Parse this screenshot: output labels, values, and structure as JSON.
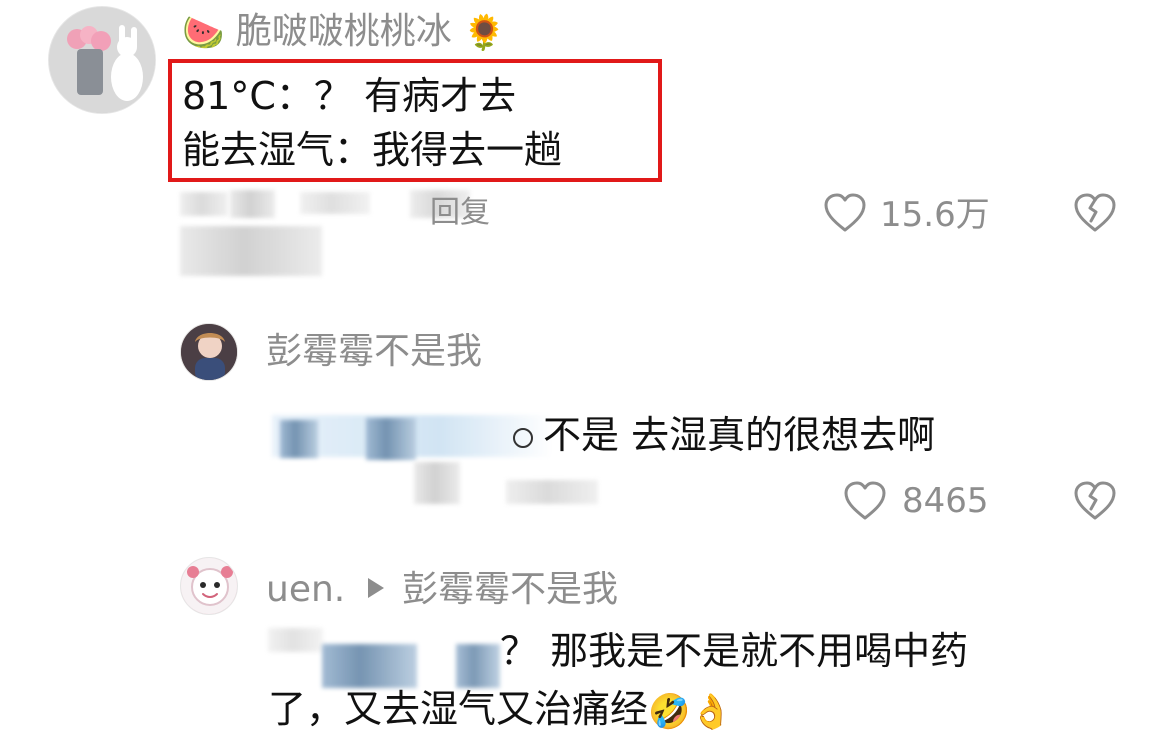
{
  "comment_1": {
    "username": "脆啵啵桃桃冰",
    "emoji_left": "🍉",
    "emoji_right": "🌻",
    "highlight_lines": [
      "81°C：？ 有病才去",
      "能去湿气：我得去一趟"
    ],
    "reply_label": "回复",
    "likes": "15.6万"
  },
  "comment_2": {
    "username": "彭霉霉不是我",
    "text": "不是 去湿真的很想去啊",
    "likes": "8465"
  },
  "comment_3": {
    "username": "uen.",
    "reply_to": "彭霉霉不是我",
    "text_line_1": "？ 那我是不是就不用喝中药",
    "text_line_2": "了，又去湿气又治痛经",
    "emoji_end_1": "🤣",
    "emoji_end_2": "👌"
  },
  "colors": {
    "highlight_border": "#e11919",
    "muted_text": "#8d8d8d",
    "text": "#111111"
  },
  "icons": {
    "like": "heart-outline-icon",
    "dislike": "broken-heart-icon",
    "reply_arrow": "triangle-right-icon"
  }
}
